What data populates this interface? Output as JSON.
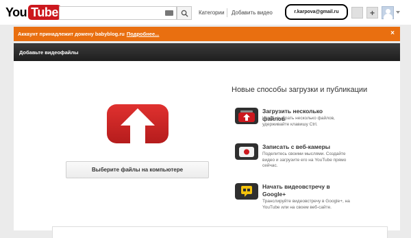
{
  "header": {
    "logo_you": "You",
    "logo_tube": "Tube",
    "search_placeholder": "",
    "nav": [
      "Категории",
      "Добавить видео"
    ],
    "account_email": "r.karpova@gmail.ru",
    "plus_label": "+"
  },
  "banner": {
    "text": "Аккаунт принадлежит домену babyblog.ru",
    "link": "Подробнее...",
    "close": "×"
  },
  "toolbar": {
    "title": "Добавьте видеофайлы"
  },
  "upload": {
    "select_button": "Выберите файлы на компьютере"
  },
  "options": {
    "title": "Новые способы загрузки и публикации",
    "items": [
      {
        "title": "Загрузить несколько файлов",
        "desc": "Чтобы выбрать несколько файлов, удерживайте клавишу Ctrl.",
        "icon": "multi-upload-icon"
      },
      {
        "title": "Записать с веб-камеры",
        "desc": "Поделитесь своими мыслями. Создайте видео и загрузите его на YouTube прямо сейчас.",
        "icon": "webcam-icon"
      },
      {
        "title": "Начать видеовстречу в Google+",
        "desc": "Транслируйте видеовстречу в Google+, на YouTube или на своем веб-сайте.",
        "icon": "hangout-icon"
      }
    ]
  },
  "colors": {
    "brand_red": "#cc181e",
    "banner_orange": "#e96f10",
    "hangout_yellow": "#f4c20d"
  }
}
